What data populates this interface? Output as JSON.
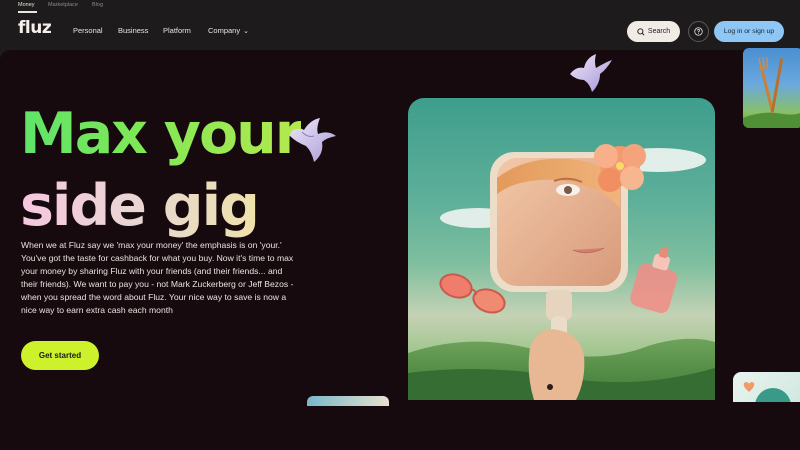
{
  "utility_nav": {
    "items": [
      {
        "label": "Money",
        "active": true
      },
      {
        "label": "Marketplace",
        "active": false
      },
      {
        "label": "Blog",
        "active": false
      }
    ]
  },
  "nav": {
    "logo": "fluz",
    "links": [
      "Personal",
      "Business",
      "Platform",
      "Company"
    ],
    "search_label": "Search",
    "login_label": "Log in or sign up"
  },
  "hero": {
    "headline_line1": "Max your",
    "headline_line2": "side gig",
    "body": "When we at Fluz say we 'max your money' the emphasis is on 'your.' You've got the taste for cashback for what you buy. Now it's time to max your money by sharing Fluz with your friends (and their friends... and their friends). We want to pay you - not Mark Zuckerberg or Jeff Bezos - when you spread the word about Fluz. Your nice way to save is now a nice way to earn extra cash each month",
    "cta_label": "Get started"
  },
  "colors": {
    "background": "#1e1b1c",
    "hero_bg": "#160a0e",
    "cta": "#cdf12a",
    "login": "#8ec7f6",
    "headline_green": "#6ee35f",
    "headline_pink": "#f4c9dd"
  },
  "icons": [
    "search-icon",
    "help-icon",
    "chevron-down-icon",
    "dove-illustration",
    "hand-mirror-illustration",
    "sunglasses-illustration",
    "perfume-illustration",
    "hibiscus-illustration"
  ]
}
